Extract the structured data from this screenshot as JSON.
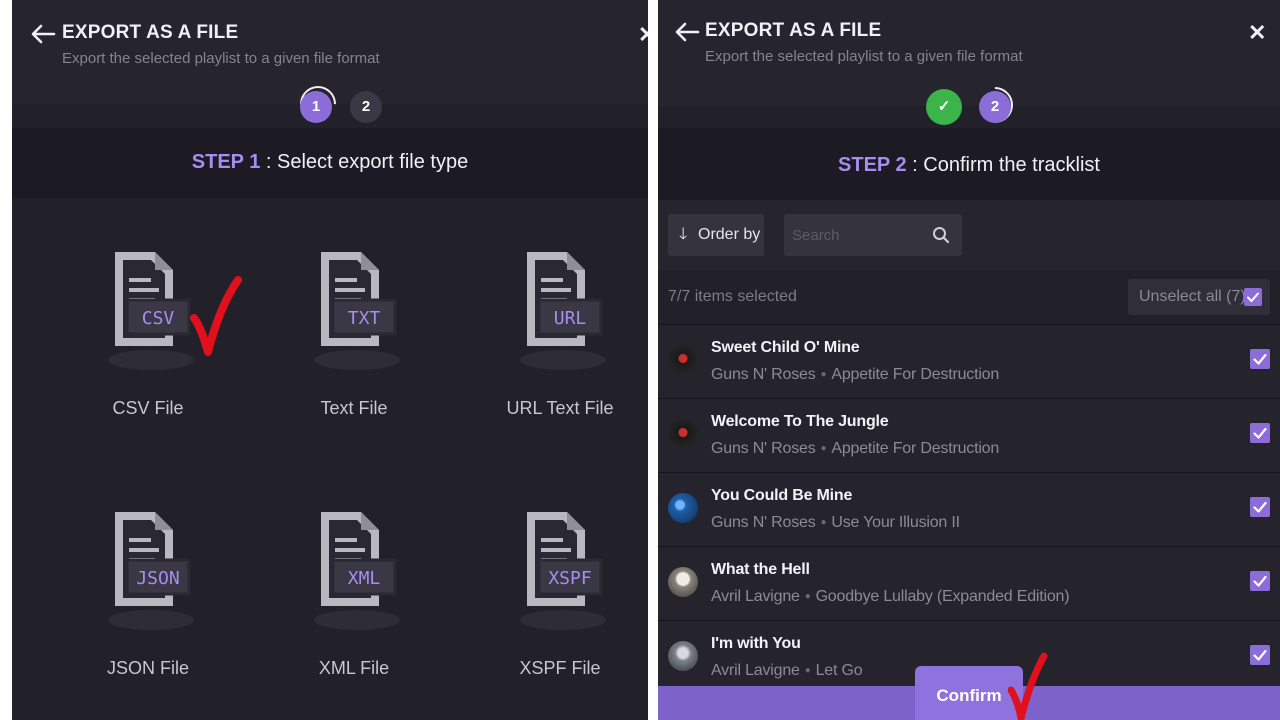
{
  "left": {
    "header": {
      "title": "EXPORT AS A FILE",
      "subtitle": "Export the selected playlist to a given file format",
      "close": "✕"
    },
    "steps": [
      {
        "label": "1",
        "state": "active"
      },
      {
        "label": "2",
        "state": "idle"
      }
    ],
    "step_text": {
      "num": "STEP 1",
      "rest": " : Select export file type"
    },
    "file_types": [
      {
        "ext": "CSV",
        "label": "CSV File",
        "selected": true
      },
      {
        "ext": "TXT",
        "label": "Text File",
        "selected": false
      },
      {
        "ext": "URL",
        "label": "URL Text File",
        "selected": false
      },
      {
        "ext": "JSON",
        "label": "JSON File",
        "selected": false
      },
      {
        "ext": "XML",
        "label": "XML File",
        "selected": false
      },
      {
        "ext": "XSPF",
        "label": "XSPF File",
        "selected": false
      }
    ]
  },
  "right": {
    "header": {
      "title": "EXPORT AS A FILE",
      "subtitle": "Export the selected playlist to a given file format",
      "close": "✕"
    },
    "steps": [
      {
        "label": "✓",
        "state": "done"
      },
      {
        "label": "2",
        "state": "active"
      }
    ],
    "step_text": {
      "num": "STEP 2",
      "rest": " : Confirm the tracklist"
    },
    "toolbar": {
      "order_by": "Order by",
      "search_placeholder": "Search"
    },
    "selection": {
      "count": "7/7 items selected",
      "unselect": "Unselect all (7)"
    },
    "tracks": [
      {
        "name": "Sweet Child O' Mine",
        "artist": "Guns N' Roses",
        "album": "Appetite For Destruction",
        "checked": true
      },
      {
        "name": "Welcome To The Jungle",
        "artist": "Guns N' Roses",
        "album": "Appetite For Destruction",
        "checked": true
      },
      {
        "name": "You Could Be Mine",
        "artist": "Guns N' Roses",
        "album": "Use Your Illusion II",
        "checked": true
      },
      {
        "name": "What the Hell",
        "artist": "Avril Lavigne",
        "album": "Goodbye Lullaby (Expanded Edition)",
        "checked": true
      },
      {
        "name": "I'm with You",
        "artist": "Avril Lavigne",
        "album": "Let Go",
        "checked": true
      }
    ],
    "confirm": "Confirm"
  },
  "colors": {
    "accent": "#8b6cd9",
    "done": "#3bb44a",
    "panel_bg": "#222029",
    "annotation": "#e0101c"
  }
}
